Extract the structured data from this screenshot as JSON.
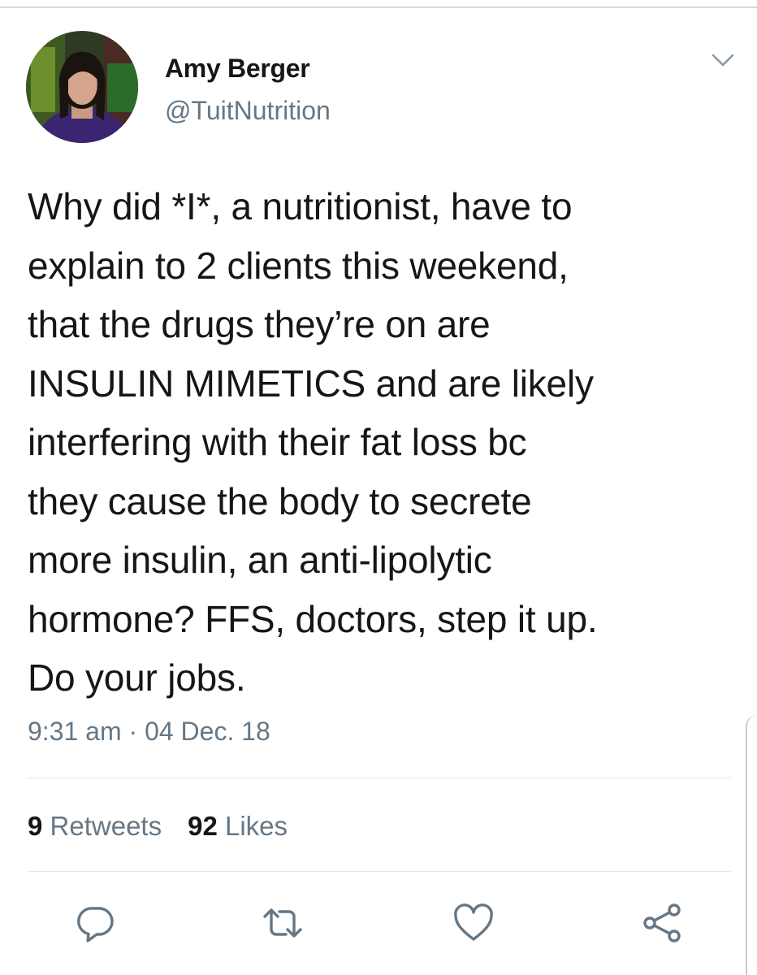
{
  "tweet": {
    "author": {
      "display_name": "Amy Berger",
      "handle": "@TuitNutrition"
    },
    "text": "Why did *I*, a nutritionist, have to\nexplain to 2 clients this weekend,\nthat the drugs they’re on are\nINSULIN MIMETICS and are likely\ninterfering with their fat loss bc\nthey cause the body to secrete\nmore insulin, an anti-lipolytic\nhormone? FFS, doctors, step it up.\nDo your jobs.",
    "timestamp": "9:31 am · 04 Dec. 18",
    "stats": {
      "retweets_count": "9",
      "retweets_label": "Retweets",
      "likes_count": "92",
      "likes_label": "Likes"
    }
  },
  "icons": {
    "menu": "chevron-down-icon",
    "reply": "reply-icon",
    "retweet": "retweet-icon",
    "like": "heart-icon",
    "share": "share-icon"
  },
  "colors": {
    "text_primary": "#14171a",
    "text_secondary": "#657786",
    "icon": "#657786",
    "divider": "#e1e8ed"
  }
}
